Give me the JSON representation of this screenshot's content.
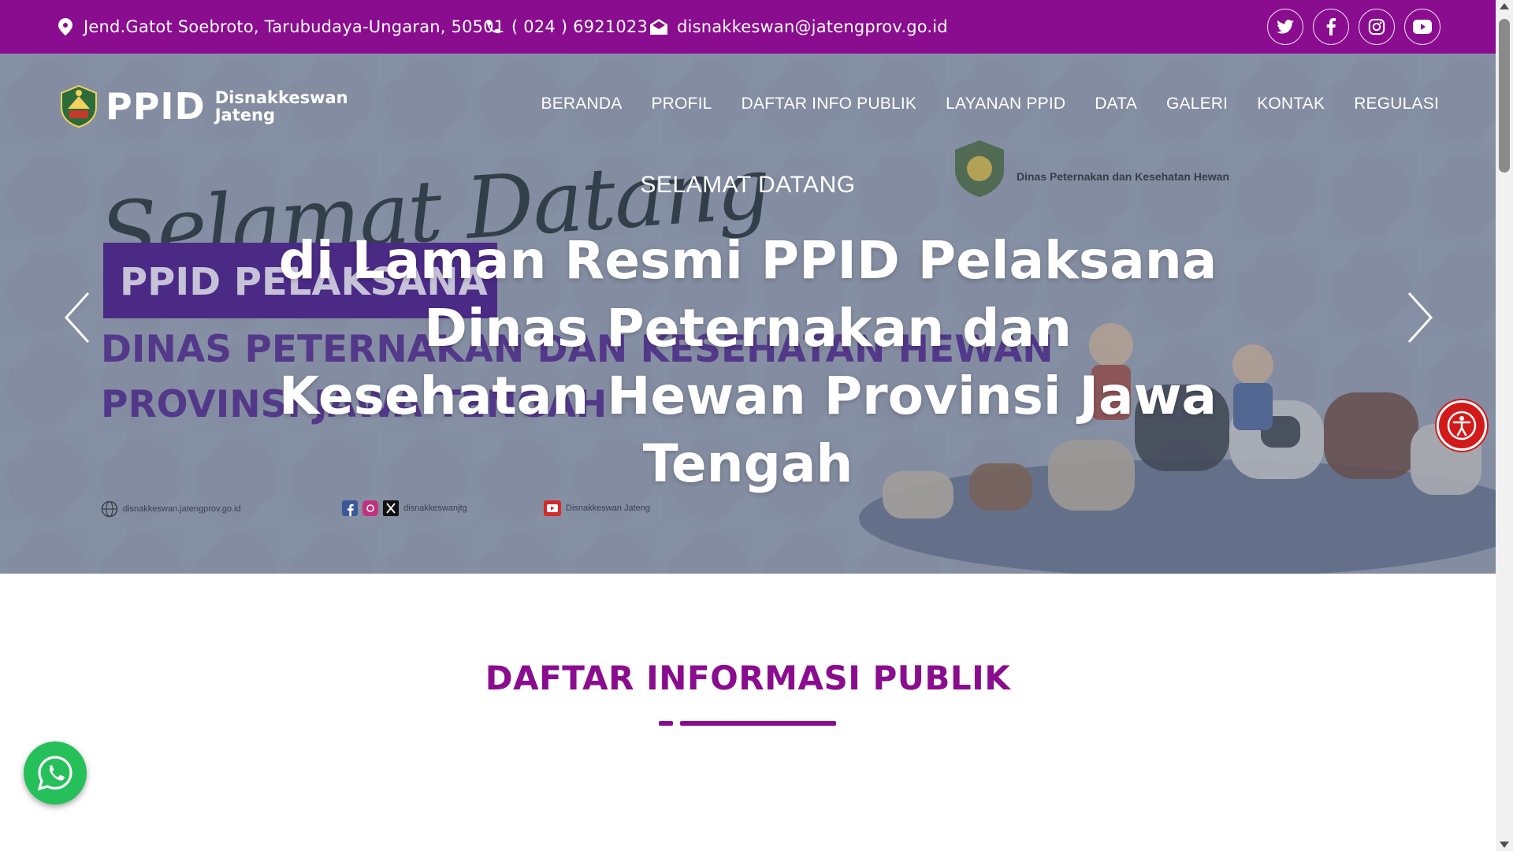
{
  "topbar": {
    "address": "Jend.Gatot Soebroto, Tarubudaya-Ungaran, 50501",
    "phone": "( 024 ) 6921023",
    "email": "disnakkeswan@jatengprov.go.id",
    "social": [
      "twitter-icon",
      "facebook-icon",
      "instagram-icon",
      "youtube-icon"
    ],
    "color": "#8a0c8f"
  },
  "logo": {
    "text": "PPID",
    "sub_line1": "Disnakkeswan",
    "sub_line2": "Jateng"
  },
  "nav": {
    "items": [
      "BERANDA",
      "PROFIL",
      "DAFTAR INFO PUBLIK",
      "LAYANAN PPID",
      "DATA",
      "GALERI",
      "KONTAK",
      "REGULASI"
    ]
  },
  "hero": {
    "bg_script": "Selamat Datang",
    "bg_band": "PPID PELAKSANA",
    "bg_line1": "DINAS PETERNAKAN DAN KESEHATAN HEWAN",
    "bg_line2": "PROVINSI JAWA TENGAH",
    "partner_text": "Dinas Peternakan dan Kesehatan Hewan",
    "subtitle": "SELAMAT DATANG",
    "title": "di Laman Resmi PPID Pelaksana Dinas Peternakan dan Kesehatan Hewan Provinsi Jawa Tengah",
    "footer_web": "disnakkeswan.jatengprov.go.id",
    "footer_social": "disnakkeswanjtg",
    "footer_youtube": "Disnakkeswan Jateng"
  },
  "section": {
    "title": "DAFTAR INFORMASI PUBLIK"
  }
}
